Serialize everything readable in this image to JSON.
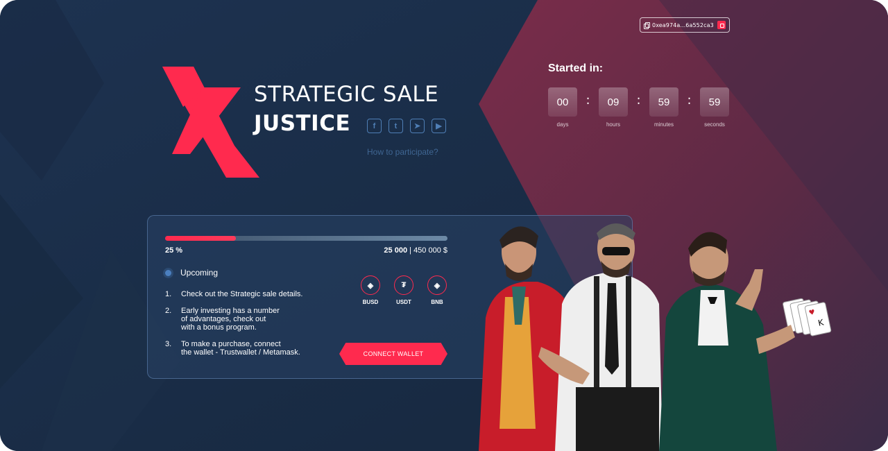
{
  "wallet": {
    "address": "0xea974a...6a552ca3",
    "icon": "wallet-icon",
    "copy_icon": "copy-icon"
  },
  "brand": {
    "logo": "x-logo",
    "title_line1": "STRATEGIC SALE",
    "title_line2": "JUSTICE",
    "socials": [
      {
        "icon": "facebook-icon",
        "glyph": "f"
      },
      {
        "icon": "twitter-icon",
        "glyph": "t"
      },
      {
        "icon": "telegram-icon",
        "glyph": "➤"
      },
      {
        "icon": "youtube-icon",
        "glyph": "▶"
      }
    ],
    "how_to": "How to participate?"
  },
  "countdown": {
    "title": "Started in:",
    "days": "00",
    "days_label": "days",
    "hours": "09",
    "hours_label": "hours",
    "minutes": "59",
    "minutes_label": "minutes",
    "seconds": "59",
    "seconds_label": "seconds",
    "separator": ":"
  },
  "sale": {
    "progress_percent": 25,
    "percent_label": "25 %",
    "raised": "25 000",
    "separator": " | ",
    "goal": "450 000 $",
    "status": "Upcoming",
    "steps": [
      {
        "num": "1.",
        "text": "Check out the Strategic sale details."
      },
      {
        "num": "2.",
        "text": "Early investing has a number\nof advantages, check out\nwith a bonus program."
      },
      {
        "num": "3.",
        "text": "To make a purchase, connect\nthe wallet - Trustwallet / Metamask."
      }
    ],
    "coins": [
      {
        "label": "BUSD",
        "icon": "busd-icon",
        "glyph": "◈"
      },
      {
        "label": "USDT",
        "icon": "usdt-icon",
        "glyph": "₮"
      },
      {
        "label": "BNB",
        "icon": "bnb-icon",
        "glyph": "◈"
      }
    ],
    "connect_button": "CONNECT WALLET"
  },
  "colors": {
    "accent": "#ff2a4e",
    "bg_dark": "#1b2d44",
    "bg_right": "#5a2c46",
    "social_blue": "#4f7fb6"
  },
  "illustration": "three-poker-characters"
}
